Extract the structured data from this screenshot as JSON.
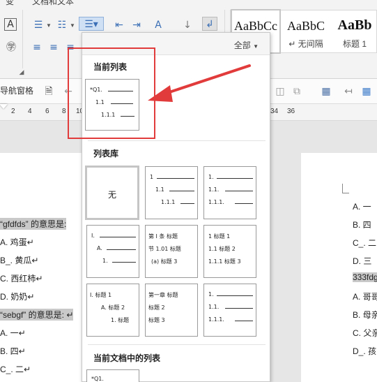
{
  "ribbon": {
    "tab_fragments": [
      "变",
      "文档和文本"
    ],
    "styles": [
      {
        "sample": "AaBbCc",
        "name": ""
      },
      {
        "sample": "AaBbC",
        "name": "↵ 无间隔"
      },
      {
        "sample": "AaBb",
        "name": "标题 1"
      }
    ]
  },
  "toolbar2": {
    "nav_pane": "导航窗格"
  },
  "ruler": {
    "ticks": [
      "2",
      "4",
      "6",
      "8",
      "10",
      "34",
      "36"
    ]
  },
  "dropdown": {
    "filter": "全部",
    "current_list_title": "当前列表",
    "library_title": "列表库",
    "doc_lists_title": "当前文档中的列表",
    "current_tile": [
      "*Q1.",
      "1.1",
      "1.1.1"
    ],
    "none_label": "无",
    "tiles": [
      {
        "lines": [
          "1",
          "1.1",
          "1.1.1"
        ]
      },
      {
        "lines": [
          "1.",
          "1.1.",
          "1.1.1."
        ]
      },
      {
        "lines": [
          "I.",
          "A.",
          "1."
        ]
      },
      {
        "lines": [
          "第 I 条 标题",
          "节 1.01 标题",
          "(a) 标题 3"
        ]
      },
      {
        "lines": [
          "1 标题 1",
          "1.1 标题 2",
          "1.1.1 标题 3"
        ]
      },
      {
        "lines": [
          "I. 标题 1",
          "A. 标题 2",
          "1. 标题"
        ]
      },
      {
        "lines": [
          "第一章 标题",
          "标题 2",
          "标题 3"
        ]
      },
      {
        "lines": [
          "1.",
          "1.1.",
          "1.1.1."
        ]
      }
    ],
    "doc_tile": [
      "*Q1."
    ]
  },
  "doc_left": {
    "lines": [
      {
        "text": "“gfdfds” 的意思是:",
        "hl": true
      },
      {
        "text": "A. 鸡蛋↵",
        "hl": false
      },
      {
        "text": "B_. 黄瓜↵",
        "hl": false
      },
      {
        "text": "C. 西红柿↵",
        "hl": false
      },
      {
        "text": "D. 奶奶↵",
        "hl": false
      },
      {
        "text": "“sebgf” 的意思是: ↵",
        "hl": true
      },
      {
        "text": "A. 一↵",
        "hl": false
      },
      {
        "text": "B. 四↵",
        "hl": false
      },
      {
        "text": "C_. 二↵",
        "hl": false
      }
    ]
  },
  "doc_right": {
    "lines": [
      {
        "text": "A. 一",
        "hl": false
      },
      {
        "text": "B. 四",
        "hl": false
      },
      {
        "text": "C_. 二",
        "hl": false
      },
      {
        "text": "D. 三",
        "hl": false
      },
      {
        "text": "333fdgf",
        "hl": true
      },
      {
        "text": "A. 哥哥",
        "hl": false
      },
      {
        "text": "B. 母亲",
        "hl": false
      },
      {
        "text": "C. 父亲",
        "hl": false
      },
      {
        "text": "D_. 孩",
        "hl": false
      }
    ]
  },
  "colors": {
    "annotation": "#e23b3b",
    "ribbon_bg": "#f3f3f3",
    "highlight": "#c9c9c9"
  }
}
